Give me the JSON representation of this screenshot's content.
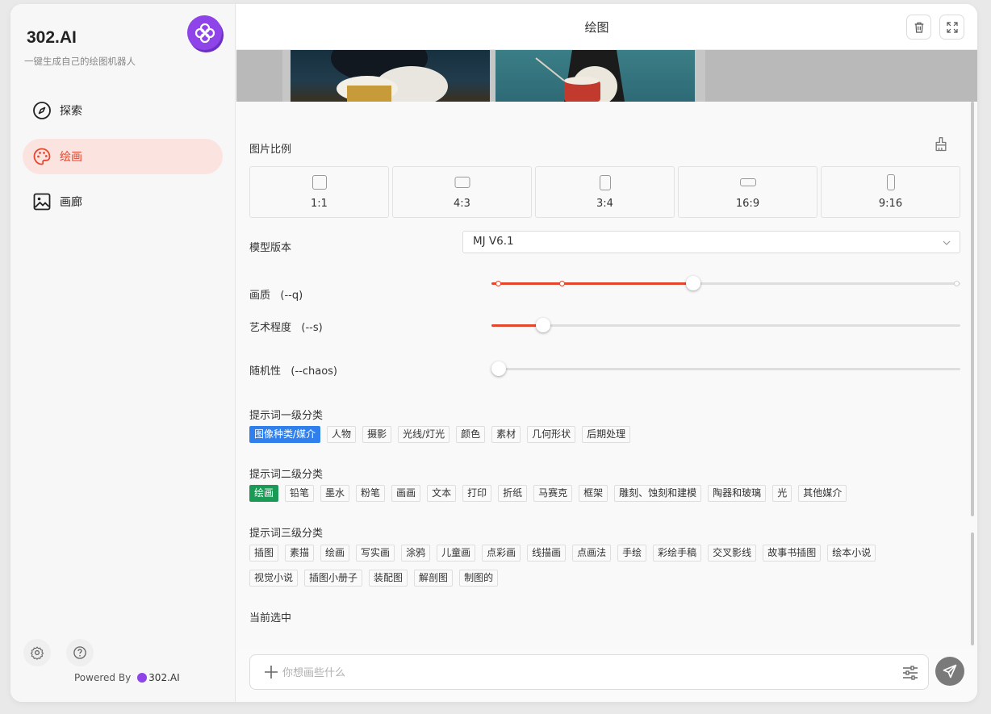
{
  "sidebar": {
    "brand": "302.AI",
    "subtitle": "一键生成自己的绘图机器人",
    "items": [
      {
        "label": "探索",
        "icon": "compass-icon"
      },
      {
        "label": "绘画",
        "icon": "palette-icon",
        "active": true
      },
      {
        "label": "画廊",
        "icon": "image-icon"
      }
    ],
    "powered_by": "Powered By",
    "powered_brand": "302.AI"
  },
  "header": {
    "title": "绘图"
  },
  "panel": {
    "ratio_label": "图片比例",
    "ratios": [
      "1:1",
      "4:3",
      "3:4",
      "16:9",
      "9:16"
    ],
    "model_label": "模型版本",
    "model_value": "MJ V6.1",
    "quality_label": "画质   (--q)",
    "quality_value": 0.43,
    "stylize_label": "艺术程度   (--s)",
    "stylize_value": 0.11,
    "chaos_label": "随机性   (--chaos)",
    "chaos_value": 0.0,
    "level1_label": "提示词一级分类",
    "level1_tags": [
      "图像种类/媒介",
      "人物",
      "摄影",
      "光线/灯光",
      "颜色",
      "素材",
      "几何形状",
      "后期处理"
    ],
    "level2_label": "提示词二级分类",
    "level2_tags": [
      "绘画",
      "铅笔",
      "墨水",
      "粉笔",
      "画画",
      "文本",
      "打印",
      "折纸",
      "马赛克",
      "框架",
      "雕刻、蚀刻和建模",
      "陶器和玻璃",
      "光",
      "其他媒介"
    ],
    "level3_label": "提示词三级分类",
    "level3_tags": [
      "插图",
      "素描",
      "绘画",
      "写实画",
      "涂鸦",
      "儿童画",
      "点彩画",
      "线描画",
      "点画法",
      "手绘",
      "彩绘手稿",
      "交叉影线",
      "故事书插图",
      "绘本小说",
      "视觉小说",
      "插图小册子",
      "装配图",
      "解剖图",
      "制图的"
    ],
    "selected_label": "当前选中"
  },
  "input": {
    "placeholder": "你想画些什么"
  },
  "colors": {
    "accent": "#e5472e",
    "brand": "#8e44e8",
    "tag_blue": "#2f80ed",
    "tag_green": "#1a9a55"
  }
}
